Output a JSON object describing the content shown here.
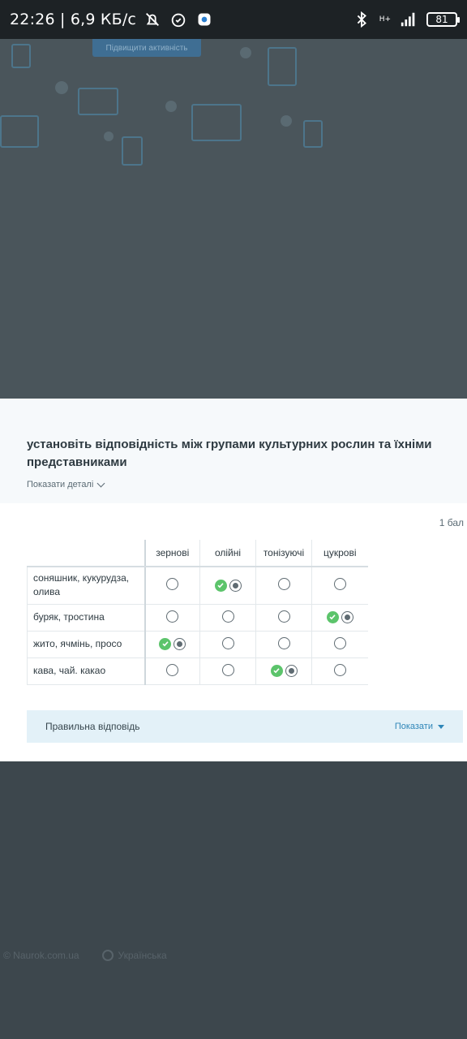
{
  "status_bar": {
    "time_speed": "22:26 | 6,9 КБ/с",
    "network": "H+",
    "battery": "81"
  },
  "background": {
    "top_button": "Підвищити активність",
    "footer_brand": "© Naurok.com.ua",
    "footer_language": "Українська"
  },
  "question": {
    "title": "установіть відповідність між групами культурних рослин та їхніми представниками",
    "details_toggle": "Показати деталі",
    "points": "1 бал"
  },
  "matrix": {
    "columns": [
      "зернові",
      "олійні",
      "тонізуючі",
      "цукрові"
    ],
    "rows": [
      {
        "label": "соняшник, кукурудза, олива",
        "selected": 1,
        "correct": 1
      },
      {
        "label": "буряк, тростина",
        "selected": 3,
        "correct": 3
      },
      {
        "label": "жито, ячмінь, просо",
        "selected": 0,
        "correct": 0
      },
      {
        "label": "кава, чай. какао",
        "selected": 2,
        "correct": 2
      }
    ]
  },
  "correct_answer": {
    "label": "Правильна відповідь",
    "show_label": "Показати"
  },
  "colors": {
    "check_green": "#5cc46b",
    "link_blue": "#2f86b8",
    "answer_bg": "#e3f1f8",
    "overlay": "#3d474d"
  }
}
